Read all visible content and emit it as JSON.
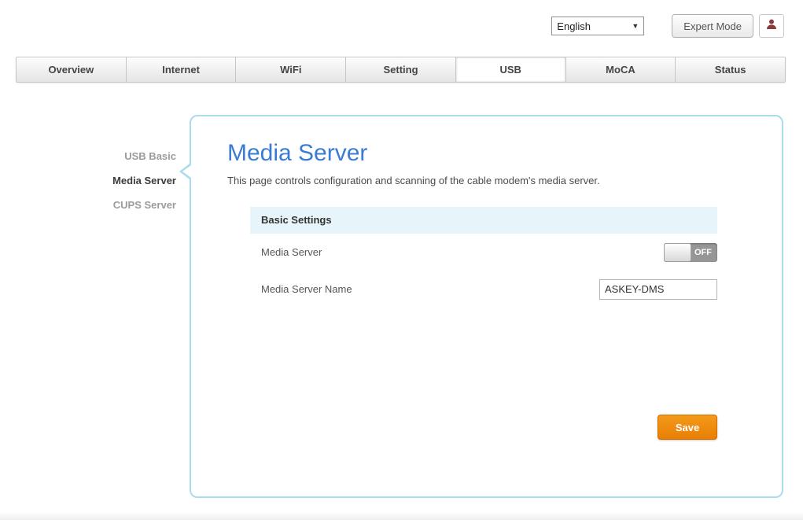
{
  "header": {
    "language": {
      "value": "English"
    },
    "expert_mode_label": "Expert Mode"
  },
  "tabs": [
    {
      "label": "Overview",
      "active": false
    },
    {
      "label": "Internet",
      "active": false
    },
    {
      "label": "WiFi",
      "active": false
    },
    {
      "label": "Setting",
      "active": false
    },
    {
      "label": "USB",
      "active": true
    },
    {
      "label": "MoCA",
      "active": false
    },
    {
      "label": "Status",
      "active": false
    }
  ],
  "sidebar": {
    "items": [
      {
        "label": "USB Basic",
        "active": false
      },
      {
        "label": "Media Server",
        "active": true
      },
      {
        "label": "CUPS Server",
        "active": false
      }
    ]
  },
  "main": {
    "title": "Media Server",
    "description": "This page controls configuration and scanning of the cable modem's media server.",
    "section": {
      "header": "Basic Settings",
      "rows": [
        {
          "label": "Media Server",
          "control": "toggle",
          "state": "OFF"
        },
        {
          "label": "Media Server Name",
          "control": "input",
          "value": "ASKEY-DMS"
        }
      ]
    },
    "save_label": "Save"
  },
  "icons": {
    "chevron": "chevron-down-icon",
    "user": "user-icon"
  },
  "colors": {
    "title_blue": "#3b7cd3",
    "panel_border": "#abdcee",
    "section_header_bg": "#e7f5fa",
    "save_orange": "#ef8c17",
    "toggle_off_bg": "#969696"
  }
}
